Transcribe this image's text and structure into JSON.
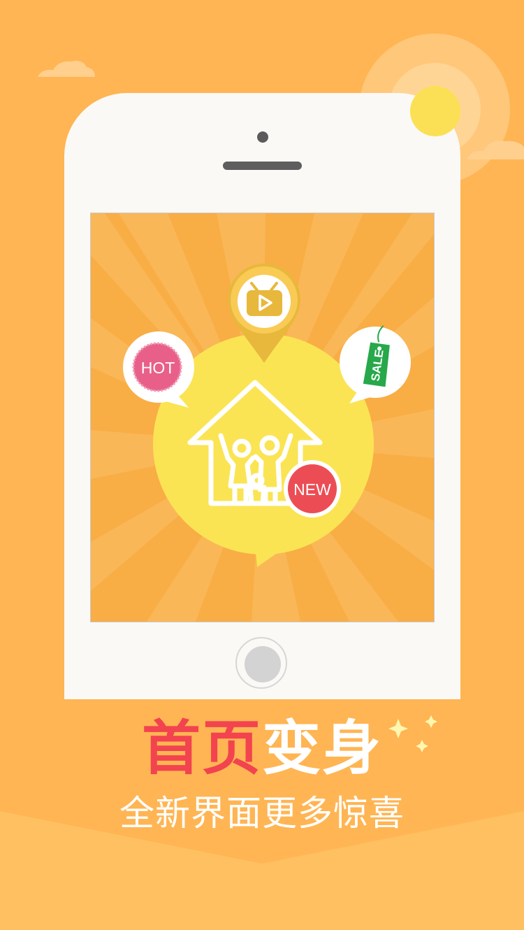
{
  "badges": {
    "hot": "HOT",
    "sale": "SALE",
    "new": "NEW"
  },
  "headline": {
    "part1": "首页",
    "part2": "变身"
  },
  "subheadline": "全新界面更多惊喜",
  "icons": {
    "tv": "tv-play-icon",
    "family_home": "family-home-icon",
    "sale_tag": "sale-tag-icon"
  },
  "colors": {
    "background": "#ffb553",
    "headline_red": "#f2434f",
    "speech_yellow": "#fbe453",
    "hot_pink": "#e8608a",
    "new_red": "#ec4d54",
    "sale_green": "#27a84a"
  }
}
